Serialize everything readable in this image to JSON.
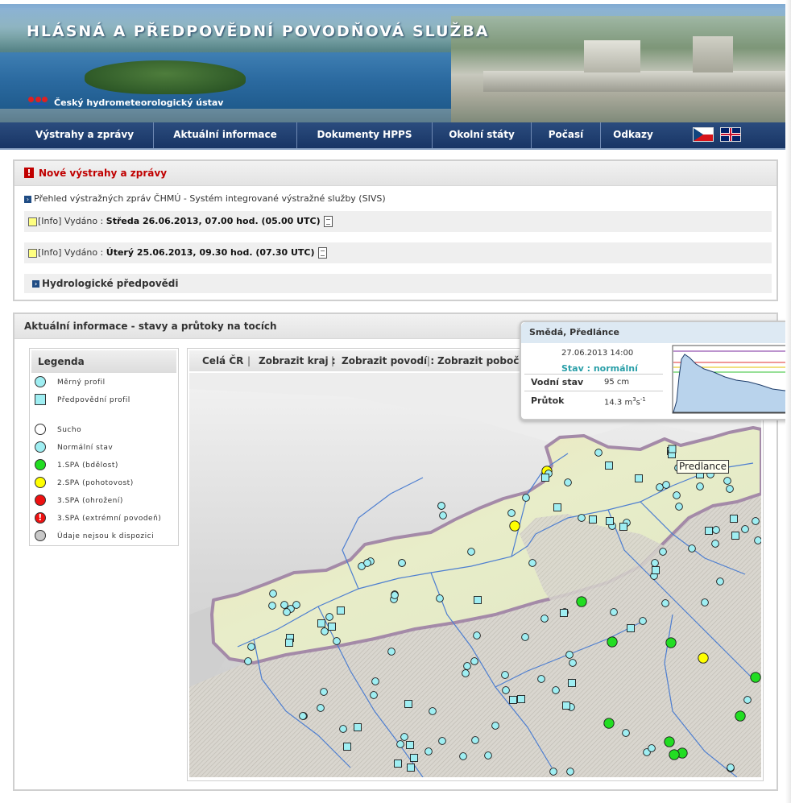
{
  "header": {
    "site_title": "HLÁSNÁ A PŘEDPOVĚDNÍ POVODŇOVÁ SLUŽBA",
    "org_name": "Český hydrometeorologický ústav"
  },
  "nav": {
    "items": [
      {
        "label": "Výstrahy a zprávy"
      },
      {
        "label": "Aktuální informace"
      },
      {
        "label": "Dokumenty HPPS"
      },
      {
        "label": "Okolní státy"
      },
      {
        "label": "Počasí"
      },
      {
        "label": "Odkazy"
      }
    ],
    "flags": [
      "czech-flag-icon",
      "uk-flag-icon"
    ]
  },
  "warnings": {
    "title": "Nové výstrahy a zprávy",
    "sivs_link": "Přehled výstražných zpráv ČHMÚ - Systém integrované výstražné služby (SIVS)",
    "items": [
      {
        "prefix": "[Info] Vydáno : ",
        "date": "Středa 26.06.2013, 07.00 hod. (05.00 UTC)"
      },
      {
        "prefix": "[Info] Vydáno : ",
        "date": "Úterý 25.06.2013, 09.30 hod. (07.30 UTC)"
      }
    ],
    "hydro_link": "Hydrologické předpovědi"
  },
  "actual": {
    "title": "Aktuální informace - stavy a průtoky na tocích"
  },
  "legend": {
    "title": "Legenda",
    "items": [
      {
        "label": "Měrný profil",
        "shape": "circle",
        "color": "#9feef2"
      },
      {
        "label": "Předpovědní profil",
        "shape": "square",
        "color": "#9feef2"
      },
      {
        "label": "Sucho",
        "shape": "circle",
        "color": "#ffffff"
      },
      {
        "label": "Normální stav",
        "shape": "circle",
        "color": "#9feef2"
      },
      {
        "label": "1.SPA (bdělost)",
        "shape": "circle",
        "color": "#22dd22"
      },
      {
        "label": "2.SPA (pohotovost)",
        "shape": "circle",
        "color": "#ffff00"
      },
      {
        "label": "3.SPA (ohrožení)",
        "shape": "circle",
        "color": "#ee1111"
      },
      {
        "label": "3.SPA (extrémní povodeň)",
        "shape": "circle-exclam",
        "color": "#ee1111"
      },
      {
        "label": "Údaje nejsou k dispozici",
        "shape": "circle",
        "color": "#c8c8c8"
      }
    ]
  },
  "map_toolbar": {
    "whole": "Celá ČR",
    "region": "Zobrazit kraj :",
    "basin": "Zobrazit povodí :",
    "branch": "Zobrazit pobočku"
  },
  "popup": {
    "station": "Smědá, Předlánce",
    "datetime": "27.06.2013 14:00",
    "state": "Stav : normální",
    "water_level_label": "Vodní stav",
    "water_level_value": "95 cm",
    "flow_label": "Průtok",
    "flow_value": "14.3 m",
    "flow_unit_sup1": "3",
    "flow_unit_mid": "s",
    "flow_unit_sup2": "-1"
  },
  "map_callout": "Predlance",
  "colors": {
    "nav_bg": "#1f3d6e",
    "warning_red": "#c00000",
    "normal": "#9feef2",
    "spa1": "#22dd22",
    "spa2": "#ffff00",
    "popup_state": "#2a9fa8"
  }
}
